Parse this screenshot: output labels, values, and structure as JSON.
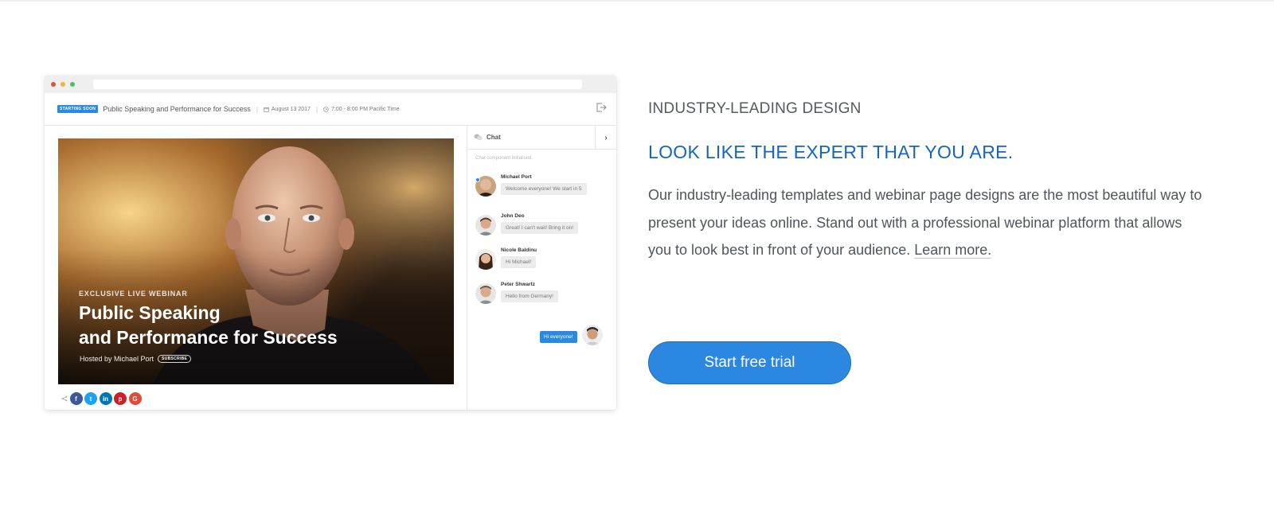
{
  "mockup": {
    "event": {
      "badge": "STARTING SOON",
      "title": "Public Speaking and Performance for Success",
      "date": "August 13 2017",
      "time": "7:00 - 8:00 PM Pacific Time"
    },
    "video": {
      "eyebrow": "EXCLUSIVE LIVE WEBINAR",
      "title_line1": "Public Speaking",
      "title_line2": "and Performance for Success",
      "host": "Hosted by Michael Port",
      "subscribe": "SUBSCRIBE"
    },
    "share": {
      "icons": [
        "share-icon",
        "facebook-icon",
        "twitter-icon",
        "linkedin-icon",
        "pinterest-icon",
        "google-plus-icon"
      ],
      "colors": {
        "facebook": "#3b5998",
        "twitter": "#1da1f2",
        "linkedin": "#0077b5",
        "pinterest": "#cb2027",
        "google": "#dd4b39"
      }
    },
    "chat": {
      "title": "Chat",
      "status": "Chat component initialised.",
      "messages": [
        {
          "name": "Michael Port",
          "text": "Welcome everyone! We start in 5"
        },
        {
          "name": "John Deo",
          "text": "Great! I can't wait! Bring it on!"
        },
        {
          "name": "Nicole Baldinu",
          "text": "Hi Michael!"
        },
        {
          "name": "Peter Shwartz",
          "text": "Hello from Germany!"
        }
      ],
      "own_message": "Hi everyone!"
    }
  },
  "copy": {
    "eyebrow": "INDUSTRY-LEADING DESIGN",
    "headline": "LOOK LIKE THE EXPERT THAT YOU ARE.",
    "body": "Our industry-leading templates and webinar page designs are the most beautiful way to present your ideas online. Stand out with a professional webinar platform that allows you to look best in front of your audience. ",
    "learn_more": "Learn more."
  },
  "cta": {
    "label": "Start free trial"
  },
  "colors": {
    "accent": "#2b87df",
    "headline": "#1565c0",
    "badge": "#2a8ae2"
  }
}
